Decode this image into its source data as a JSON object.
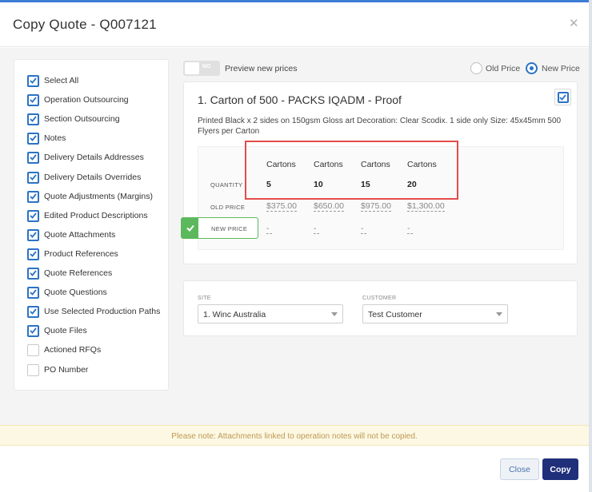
{
  "dialog": {
    "title": "Copy Quote - Q007121",
    "close_icon": "close-icon"
  },
  "options": [
    {
      "label": "Select All",
      "checked": true
    },
    {
      "label": "Operation Outsourcing",
      "checked": true
    },
    {
      "label": "Section Outsourcing",
      "checked": true
    },
    {
      "label": "Notes",
      "checked": true
    },
    {
      "label": "Delivery Details Addresses",
      "checked": true
    },
    {
      "label": "Delivery Details Overrides",
      "checked": true
    },
    {
      "label": "Quote Adjustments (Margins)",
      "checked": true
    },
    {
      "label": "Edited Product Descriptions",
      "checked": true
    },
    {
      "label": "Quote Attachments",
      "checked": true
    },
    {
      "label": "Product References",
      "checked": true
    },
    {
      "label": "Quote References",
      "checked": true
    },
    {
      "label": "Quote Questions",
      "checked": true
    },
    {
      "label": "Use Selected Production Paths",
      "checked": true
    },
    {
      "label": "Quote Files",
      "checked": true
    },
    {
      "label": "Actioned RFQs",
      "checked": false
    },
    {
      "label": "PO Number",
      "checked": false
    }
  ],
  "preview": {
    "toggle_text": "NO",
    "label": "Preview new prices",
    "old_price_label": "Old Price",
    "new_price_label": "New Price",
    "selected": "New Price"
  },
  "product": {
    "title": "1. Carton of 500 - PACKS IQADM - Proof",
    "description": "Printed Black x 2 sides on 150gsm Gloss art Decoration: Clear Scodix. 1 side only Size: 45x45mm 500 Flyers per Carton",
    "checked": true,
    "units": [
      "Cartons",
      "Cartons",
      "Cartons",
      "Cartons"
    ],
    "quantity_label": "QUANTITY",
    "quantities": [
      "5",
      "10",
      "15",
      "20"
    ],
    "old_price_label": "OLD PRICE",
    "old_prices": [
      "$375.00",
      "$650.00",
      "$975.00",
      "$1,300.00"
    ],
    "new_price_label": "NEW PRICE",
    "new_prices": [
      "-",
      "-",
      "-",
      "-"
    ]
  },
  "site": {
    "label": "SITE",
    "value": "1. Winc Australia"
  },
  "customer": {
    "label": "CUSTOMER",
    "value": "Test Customer"
  },
  "note": "Please note: Attachments linked to operation notes will not be copied.",
  "footer": {
    "close_label": "Close",
    "copy_label": "Copy"
  },
  "colors": {
    "accent": "#2b73c6",
    "primary_button": "#1f2f7a",
    "success": "#5cb85c",
    "highlight": "#e34b4b",
    "note_text": "#c09853"
  }
}
